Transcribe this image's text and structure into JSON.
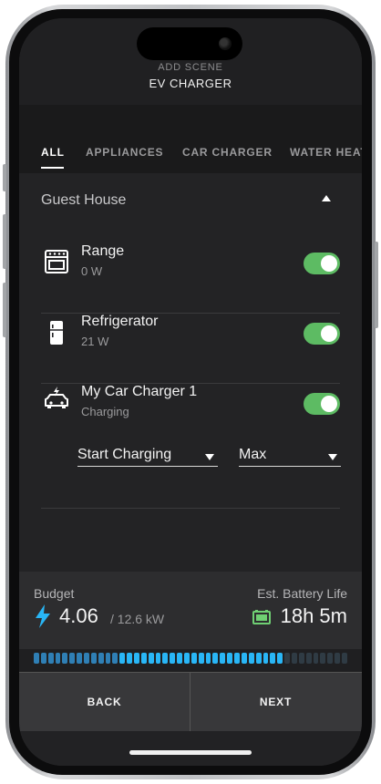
{
  "header": {
    "subtitle": "ADD SCENE",
    "title": "EV CHARGER"
  },
  "tabs": [
    {
      "label": "ALL",
      "active": true
    },
    {
      "label": "APPLIANCES"
    },
    {
      "label": "CAR CHARGER"
    },
    {
      "label": "WATER HEATER"
    }
  ],
  "group": {
    "title": "Guest House",
    "expanded": true
  },
  "devices": [
    {
      "name": "Range",
      "status": "0 W",
      "icon": "oven-icon",
      "on": true
    },
    {
      "name": "Refrigerator",
      "status": "21 W",
      "icon": "refrigerator-icon",
      "on": true
    },
    {
      "name": "My Car Charger 1",
      "status": "Charging",
      "icon": "car-charger-icon",
      "on": true
    }
  ],
  "charger_controls": {
    "action": "Start Charging",
    "level": "Max"
  },
  "budget": {
    "label": "Budget",
    "value": "4.06",
    "max": "/ 12.6 kW",
    "battery_label": "Est. Battery Life",
    "battery_value": "18h 5m",
    "meter_fraction": 0.8
  },
  "footer": {
    "back": "BACK",
    "next": "NEXT"
  },
  "colors": {
    "accent": "#29b6f6",
    "toggle_on": "#5dbb63",
    "battery": "#6fcf73"
  }
}
